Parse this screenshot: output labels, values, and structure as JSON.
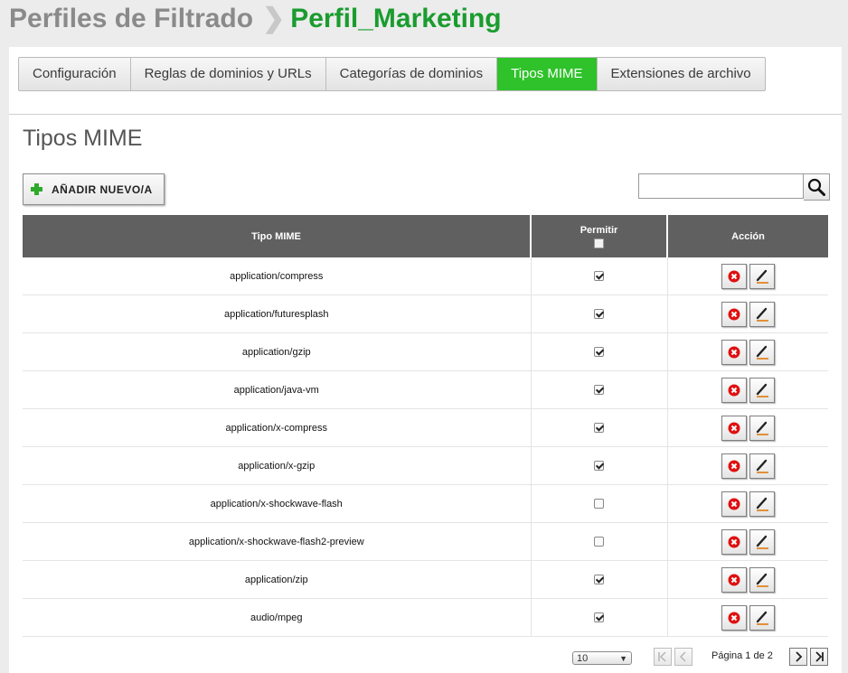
{
  "header": {
    "section": "Perfiles de Filtrado",
    "separator": "❯",
    "current": "Perfil_Marketing"
  },
  "tabs": [
    {
      "label": "Configuración",
      "active": false
    },
    {
      "label": "Reglas de dominios y URLs",
      "active": false
    },
    {
      "label": "Categorías de dominios",
      "active": false
    },
    {
      "label": "Tipos MIME",
      "active": true
    },
    {
      "label": "Extensiones de archivo",
      "active": false
    }
  ],
  "content": {
    "title": "Tipos MIME",
    "add_label": "AÑADIR NUEVO/A",
    "search_value": ""
  },
  "table": {
    "columns": {
      "mime": "Tipo MIME",
      "allow": "Permitir",
      "action": "Acción"
    },
    "rows": [
      {
        "mime": "application/compress",
        "allow": true
      },
      {
        "mime": "application/futuresplash",
        "allow": true
      },
      {
        "mime": "application/gzip",
        "allow": true
      },
      {
        "mime": "application/java-vm",
        "allow": true
      },
      {
        "mime": "application/x-compress",
        "allow": true
      },
      {
        "mime": "application/x-gzip",
        "allow": true
      },
      {
        "mime": "application/x-shockwave-flash",
        "allow": false
      },
      {
        "mime": "application/x-shockwave-flash2-preview",
        "allow": false
      },
      {
        "mime": "application/zip",
        "allow": true
      },
      {
        "mime": "audio/mpeg",
        "allow": true
      }
    ]
  },
  "pager": {
    "page_size": "10",
    "page_info": "Página 1 de 2"
  },
  "icons": {
    "add": "plus-icon",
    "search": "search-icon",
    "delete": "delete-icon",
    "edit": "edit-icon",
    "first": "first-page-icon",
    "prev": "prev-page-icon",
    "next": "next-page-icon",
    "last": "last-page-icon"
  },
  "colors": {
    "accent": "#2fc22b",
    "title_green": "#1a9c2e",
    "header_bg": "#606060",
    "delete_red": "#e01010"
  }
}
